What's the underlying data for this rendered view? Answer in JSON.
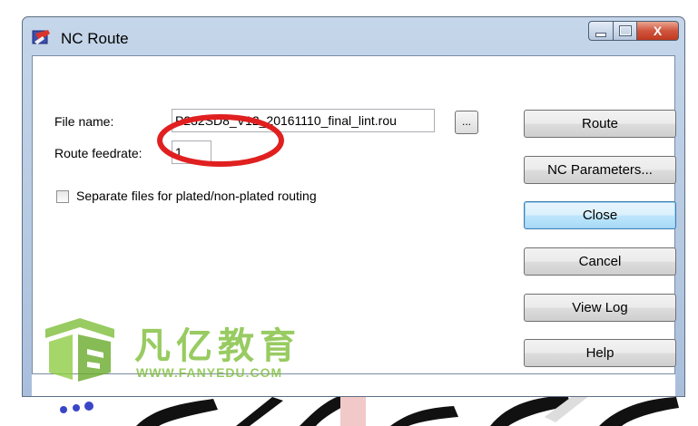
{
  "window": {
    "title": "NC Route",
    "close_glyph": "X"
  },
  "form": {
    "file_name_label": "File name:",
    "file_name_value": "P232SD8_V12_20161110_final_lint.rou",
    "browse_label": "...",
    "feedrate_label": "Route feedrate:",
    "feedrate_value": "1",
    "separate_files_label": "Separate files for plated/non-plated routing",
    "separate_files_checked": false
  },
  "buttons": {
    "route": "Route",
    "nc_parameters": "NC Parameters...",
    "close": "Close",
    "cancel": "Cancel",
    "view_log": "View Log",
    "help": "Help"
  },
  "watermark": {
    "chinese_text": "凡亿教育",
    "url_text": "WWW.FANYEDU.COM",
    "color": "#7fbf3a"
  },
  "annotation": {
    "shape": "red-ellipse",
    "color": "#e02020"
  }
}
